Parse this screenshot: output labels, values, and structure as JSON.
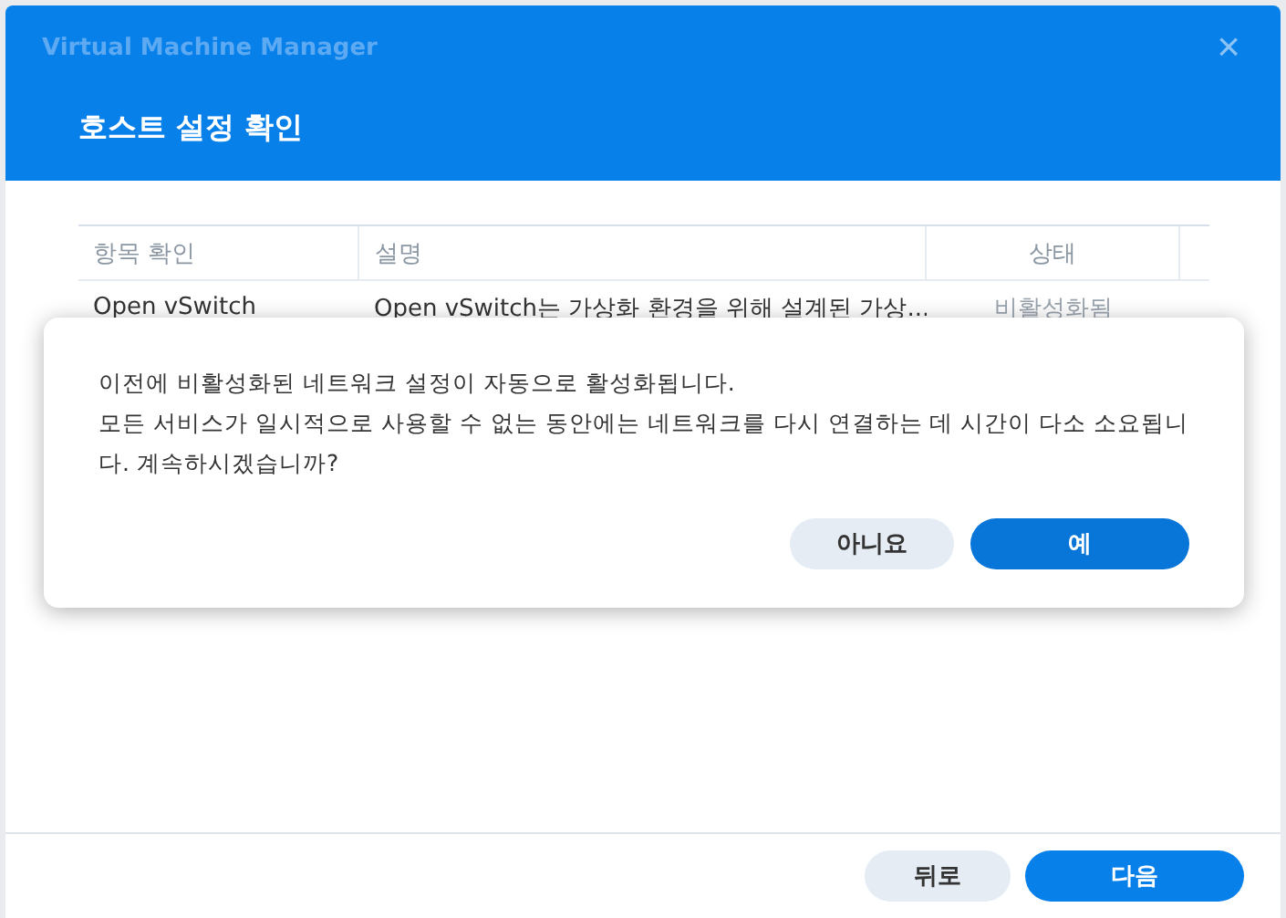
{
  "window": {
    "title": "Virtual Machine Manager",
    "heading": "호스트 설정 확인",
    "close": "×"
  },
  "table": {
    "columns": [
      "항목 확인",
      "설명",
      "상태"
    ],
    "rows": [
      {
        "cells": [
          "Open vSwitch",
          "Open vSwitch는 가상화 환경을 위해 설계된 가상...",
          "비활성화됨"
        ]
      }
    ]
  },
  "footer": {
    "buttons": [
      {
        "label": "뒤로",
        "kind": "secondary"
      },
      {
        "label": "다음",
        "kind": "primary"
      }
    ]
  },
  "dialog": {
    "message": [
      "이전에 비활성화된 네트워크 설정이 자동으로 활성화됩니다.",
      "모든 서비스가 일시적으로 사용할 수 없는 동안에는 네트워크를 다시 연결하는 데 시간이 다소 소요됩니다. 계속하시겠습니까?"
    ],
    "buttons": [
      {
        "label": "아니요",
        "kind": "secondary"
      },
      {
        "label": "예",
        "kind": "primary"
      }
    ]
  }
}
